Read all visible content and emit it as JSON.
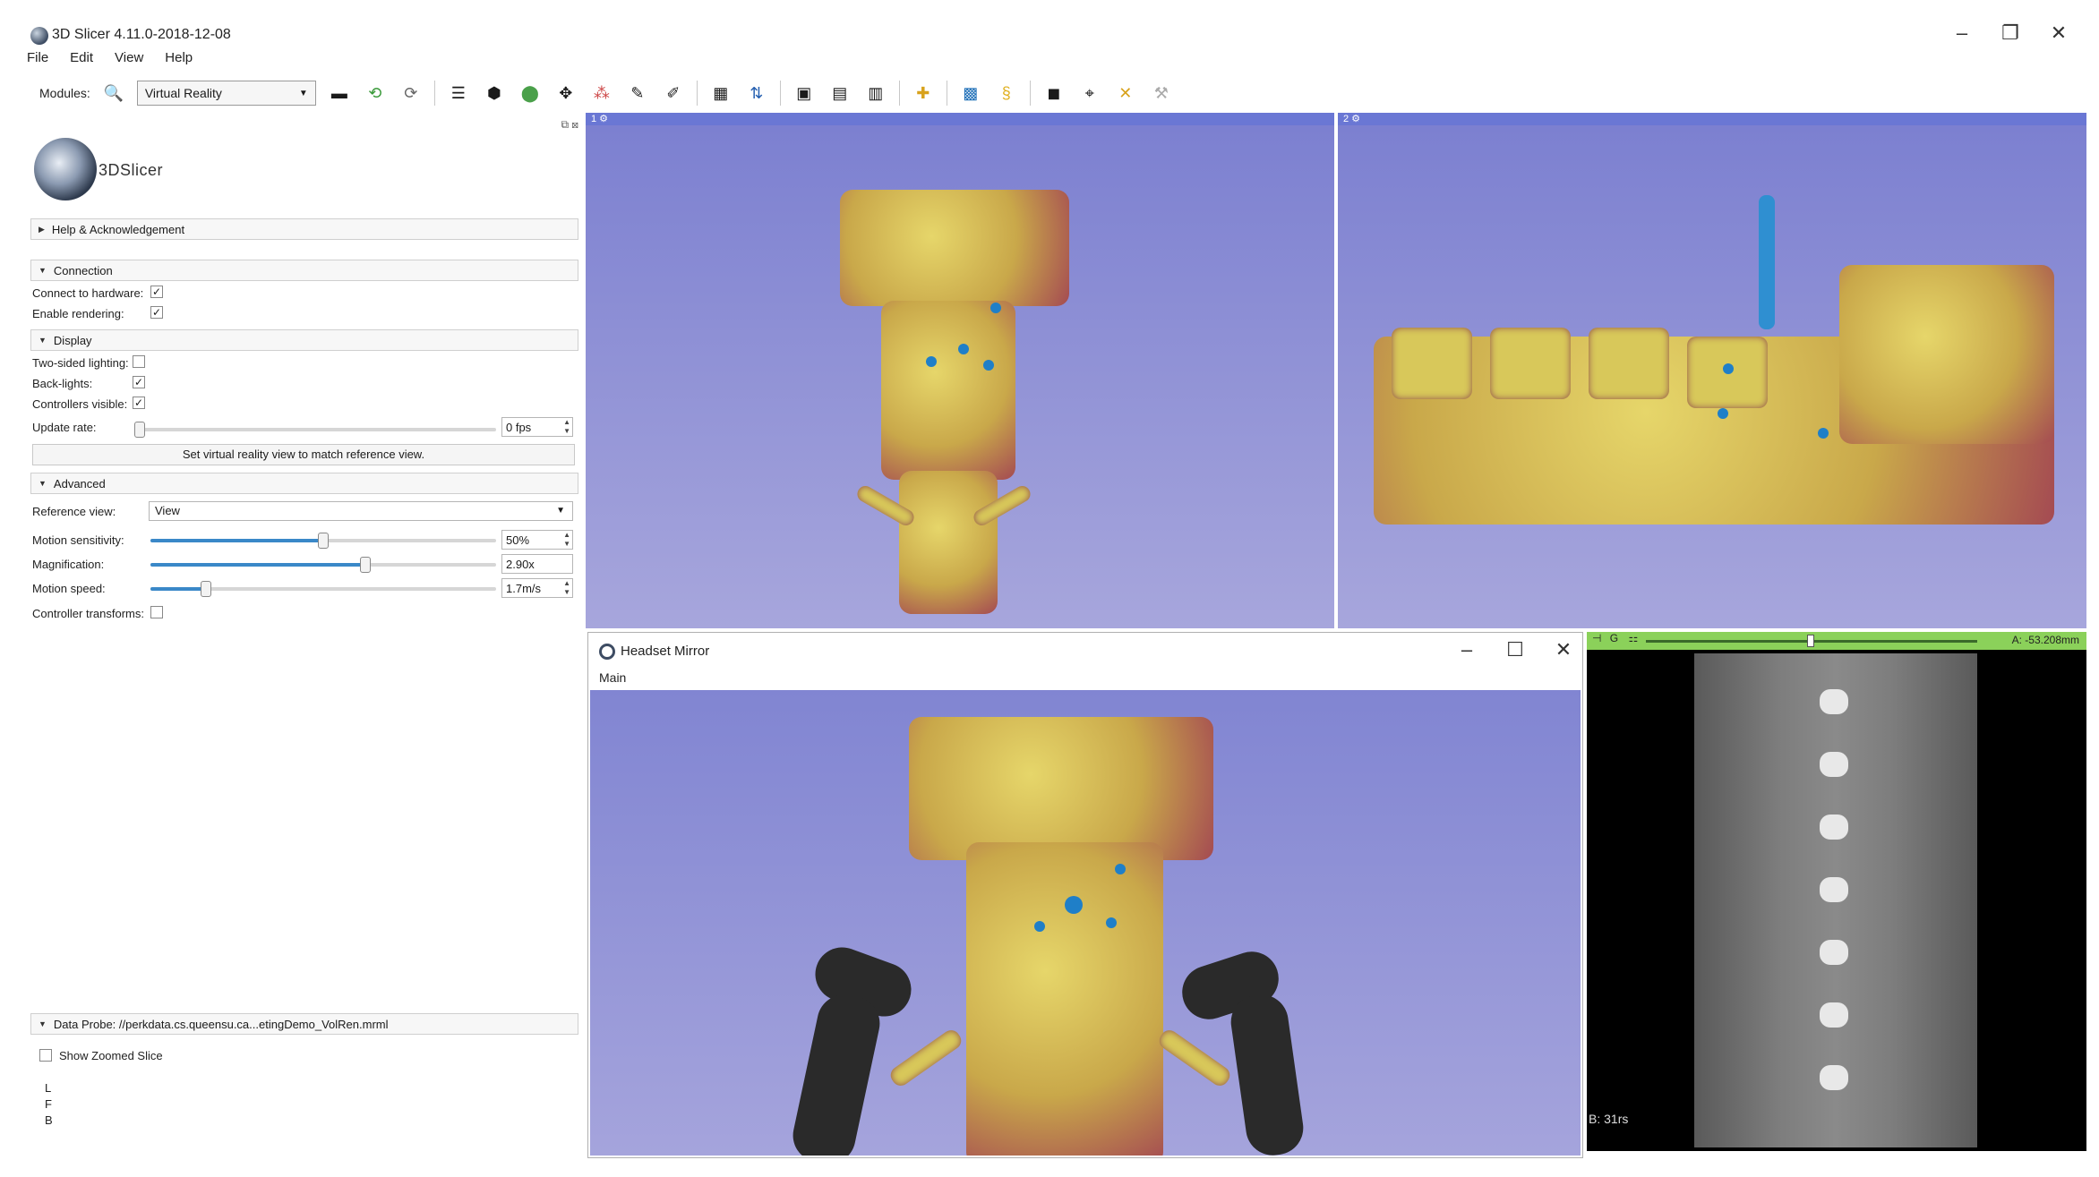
{
  "window": {
    "title": "3D Slicer 4.11.0-2018-12-08"
  },
  "menu": [
    "File",
    "Edit",
    "View",
    "Help"
  ],
  "toolbar": {
    "modules_label": "Modules:",
    "module_selected": "Virtual Reality"
  },
  "left_panel": {
    "brand": "3DSlicer",
    "help_section": "Help & Acknowledgement",
    "connection_section": "Connection",
    "connect_to_hardware": "Connect to hardware:",
    "enable_rendering": "Enable rendering:",
    "display_section": "Display",
    "two_sided_lighting": "Two-sided lighting:",
    "back_lights": "Back-lights:",
    "controllers_visible": "Controllers visible:",
    "update_rate_label": "Update rate:",
    "update_rate_value": "0 fps",
    "match_button": "Set virtual reality view to match reference view.",
    "advanced_section": "Advanced",
    "reference_view_label": "Reference view:",
    "reference_view_value": "View",
    "motion_sensitivity_label": "Motion sensitivity:",
    "motion_sensitivity_value": "50%",
    "magnification_label": "Magnification:",
    "magnification_value": "2.90x",
    "motion_speed_label": "Motion speed:",
    "motion_speed_value": "1.7m/s",
    "controller_transforms_label": "Controller transforms:",
    "data_probe_section": "Data Probe: //perkdata.cs.queensu.ca...etingDemo_VolRen.mrml",
    "show_zoomed_slice": "Show Zoomed Slice",
    "probe_L": "L",
    "probe_F": "F",
    "probe_B": "B"
  },
  "views": {
    "view1_label": "1",
    "view2_label": "2"
  },
  "headset_mirror": {
    "title": "Headset Mirror",
    "menu": "Main"
  },
  "slice_view": {
    "label": "G",
    "offset": "A: -53.208mm",
    "corner": "B: 31rs"
  }
}
